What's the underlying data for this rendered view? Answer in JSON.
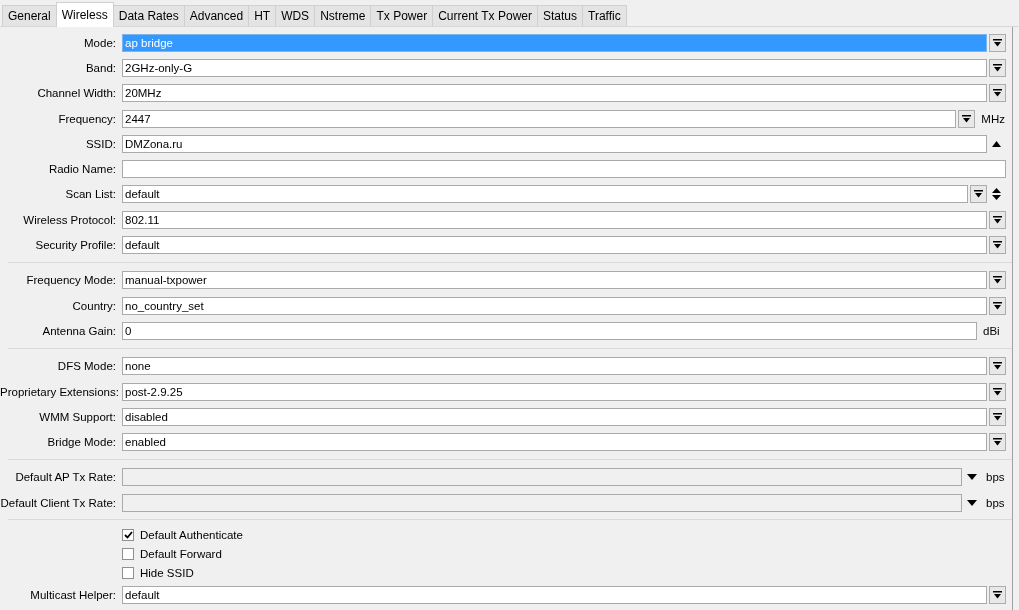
{
  "tabs": [
    {
      "label": "General",
      "selected": false
    },
    {
      "label": "Wireless",
      "selected": true
    },
    {
      "label": "Data Rates",
      "selected": false
    },
    {
      "label": "Advanced",
      "selected": false
    },
    {
      "label": "HT",
      "selected": false
    },
    {
      "label": "WDS",
      "selected": false
    },
    {
      "label": "Nstreme",
      "selected": false
    },
    {
      "label": "Tx Power",
      "selected": false
    },
    {
      "label": "Current Tx Power",
      "selected": false
    },
    {
      "label": "Status",
      "selected": false
    },
    {
      "label": "Traffic",
      "selected": false
    }
  ],
  "groups": [
    {
      "fields": [
        {
          "kind": "dropdown",
          "label": "Mode:",
          "value": "ap bridge",
          "selected": true,
          "disabled": false
        },
        {
          "kind": "dropdown",
          "label": "Band:",
          "value": "2GHz-only-G",
          "selected": false,
          "disabled": false
        },
        {
          "kind": "dropdown",
          "label": "Channel Width:",
          "value": "20MHz",
          "selected": false,
          "disabled": false
        },
        {
          "kind": "dropdown-unit",
          "label": "Frequency:",
          "value": "2447",
          "unit": "MHz",
          "selected": false,
          "disabled": false
        },
        {
          "kind": "collapse",
          "label": "SSID:",
          "value": "DMZona.ru",
          "selected": false,
          "disabled": false
        },
        {
          "kind": "text",
          "label": "Radio Name:",
          "selected": false,
          "disabled": false
        },
        {
          "kind": "list",
          "label": "Scan List:",
          "value": "default",
          "selected": false,
          "disabled": false
        },
        {
          "kind": "dropdown",
          "label": "Wireless Protocol:",
          "value": "802.11",
          "selected": false,
          "disabled": false
        },
        {
          "kind": "dropdown",
          "label": "Security Profile:",
          "value": "default",
          "selected": false,
          "disabled": false
        }
      ]
    },
    {
      "fields": [
        {
          "kind": "dropdown",
          "label": "Frequency Mode:",
          "value": "manual-txpower",
          "selected": false,
          "disabled": false
        },
        {
          "kind": "dropdown",
          "label": "Country:",
          "value": "no_country_set",
          "selected": false,
          "disabled": false
        },
        {
          "kind": "unit",
          "label": "Antenna Gain:",
          "value": "0",
          "unit": "dBi",
          "selected": false,
          "disabled": false
        }
      ]
    },
    {
      "fields": [
        {
          "kind": "dropdown",
          "label": "DFS Mode:",
          "value": "none",
          "selected": false,
          "disabled": false
        },
        {
          "kind": "dropdown",
          "label": "Proprietary Extensions:",
          "value": "post-2.9.25",
          "selected": false,
          "disabled": false
        },
        {
          "kind": "dropdown",
          "label": "WMM Support:",
          "value": "disabled",
          "selected": false,
          "disabled": false
        },
        {
          "kind": "dropdown",
          "label": "Bridge Mode:",
          "value": "enabled",
          "selected": false,
          "disabled": false
        }
      ]
    },
    {
      "fields": [
        {
          "kind": "rate",
          "label": "Default AP Tx Rate:",
          "unit": "bps",
          "selected": false,
          "disabled": true
        },
        {
          "kind": "rate",
          "label": "Default Client Tx Rate:",
          "unit": "bps",
          "selected": false,
          "disabled": true
        }
      ]
    },
    {
      "fields": [
        {
          "kind": "checkbox",
          "label": "Default Authenticate",
          "checked": true
        },
        {
          "kind": "checkbox",
          "label": "Default Forward",
          "checked": false
        },
        {
          "kind": "checkbox",
          "label": "Hide SSID",
          "checked": false
        },
        {
          "kind": "dropdown",
          "label": "Multicast Helper:",
          "value": "default",
          "selected": false,
          "disabled": false
        }
      ]
    }
  ]
}
